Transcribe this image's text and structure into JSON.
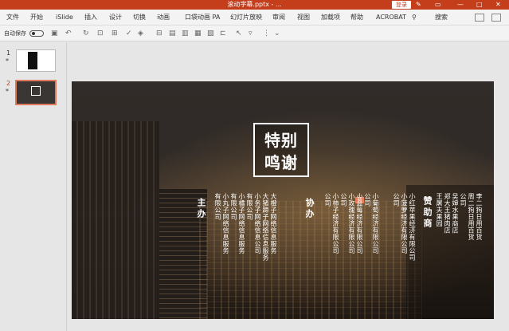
{
  "window": {
    "title": "滚动字幕.pptx - ...",
    "login_label": "登录",
    "icons": [
      "pen-icon",
      "ribbon-display-icon",
      "minimize-icon",
      "maximize-icon",
      "close-icon"
    ]
  },
  "menu": {
    "tabs": [
      "文件",
      "开始",
      "iSlide",
      "插入",
      "设计",
      "切换",
      "动画",
      "口袋动画 PA",
      "幻灯片放映",
      "审阅",
      "视图",
      "加载项",
      "帮助",
      "ACROBAT"
    ],
    "tell_me_icon": "lightbulb-icon",
    "search_label": "搜索"
  },
  "quick_access": {
    "autosave_label": "自动保存",
    "autosave_state": "关"
  },
  "thumbnails": [
    {
      "number": "1",
      "mark": "*"
    },
    {
      "number": "2",
      "mark": "*",
      "selected": true
    }
  ],
  "slide": {
    "title_line1": "特别",
    "title_line2": "鸣谢",
    "host_label": "主办",
    "host_orgs": [
      "大橙子网络信息服务",
      "大猪蹄子网络信息服务",
      "小务子网络信息公司",
      "有限公司",
      "小橘子网络信息服务",
      "有限公司",
      "小丸子网络信息服务",
      "有限公司"
    ],
    "co_label": "协办",
    "co_orgs": [
      "小葡萄经济有限公司",
      "公司",
      "小蓝莓经济有限公司",
      "小玫瑰经济有限公司",
      "公司",
      "小柿子经济有限公司",
      "公司"
    ],
    "co_highlight": "蓝",
    "sponsor_label": "赞助商",
    "sponsor_orgs": [
      "小红苹果经济有限公司",
      "小菠萝经济有限公司",
      "公司"
    ],
    "personal_orgs": [
      "李二狗日用百货",
      "周二狗日用百货",
      "公司",
      "吴婶水果商店",
      "郑大王猪肉店",
      "王屠夫果园"
    ]
  }
}
